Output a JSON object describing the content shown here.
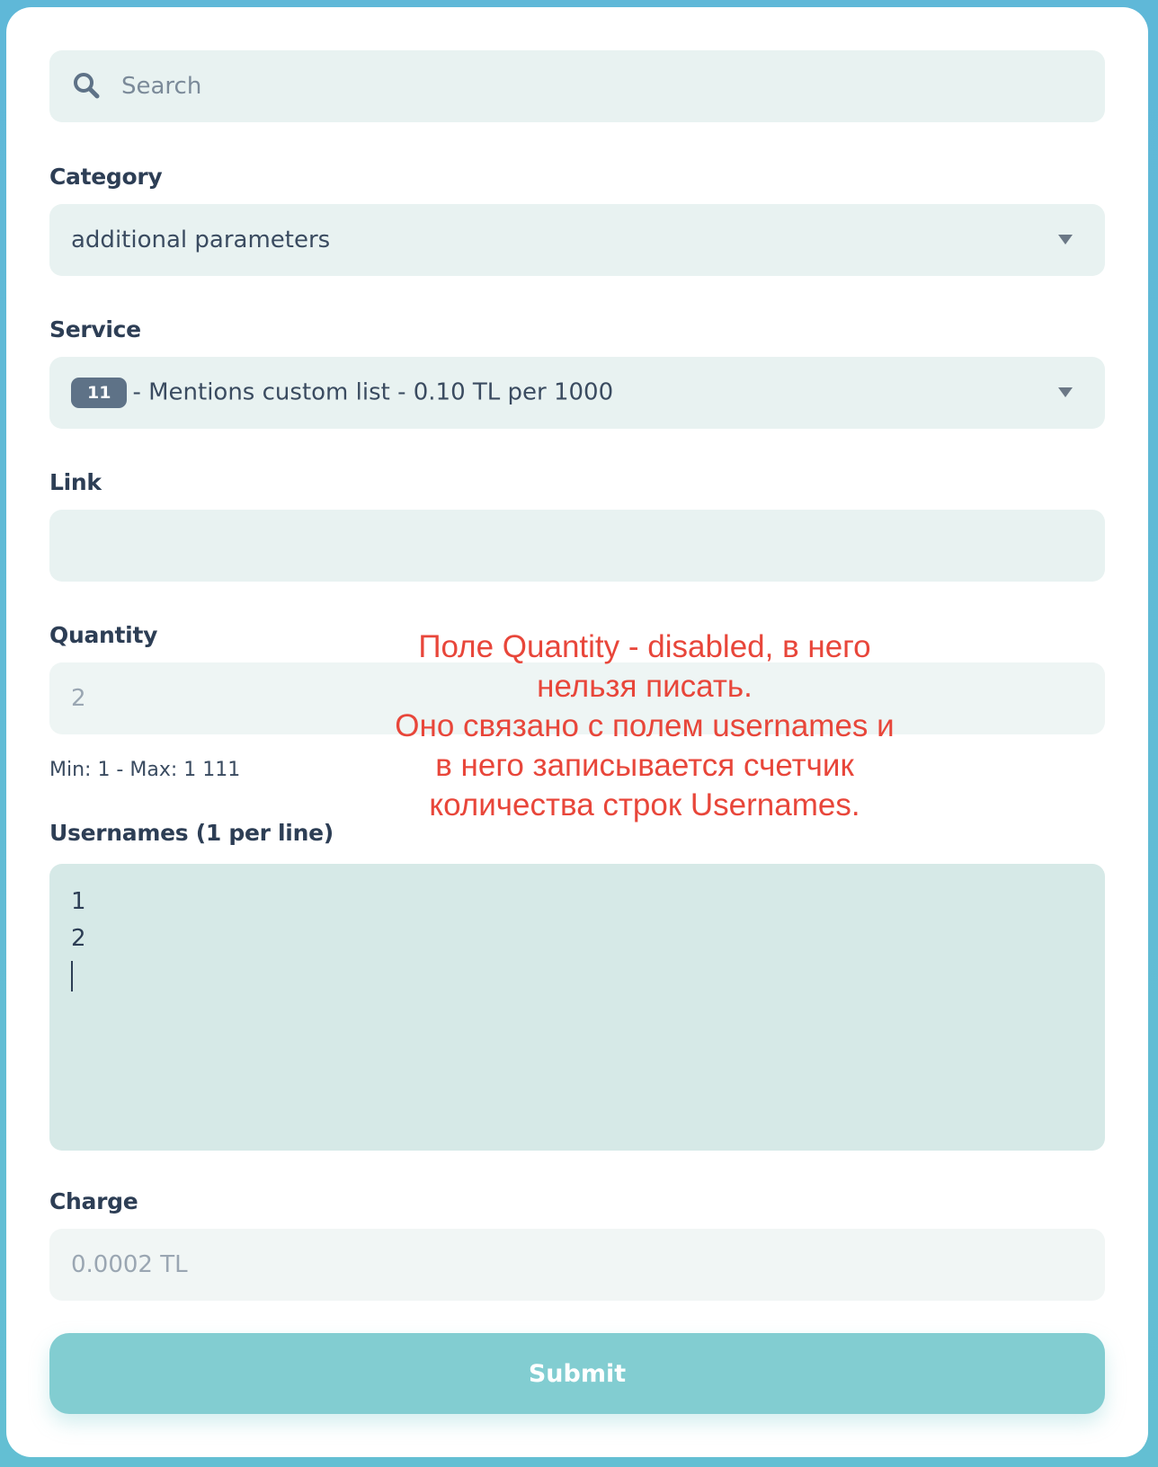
{
  "search": {
    "placeholder": "Search",
    "icon": "search-icon"
  },
  "category": {
    "label": "Category",
    "selected": "additional parameters"
  },
  "service": {
    "label": "Service",
    "badge": "11",
    "selected": "- Mentions custom list - 0.10 TL per 1000"
  },
  "link": {
    "label": "Link",
    "value": ""
  },
  "quantity": {
    "label": "Quantity",
    "value": "2",
    "hint": "Min: 1 - Max: 1 111"
  },
  "usernames": {
    "label": "Usernames (1 per line)",
    "lines": [
      "1",
      "2"
    ]
  },
  "charge": {
    "label": "Charge",
    "value": "0.0002 TL"
  },
  "submit": {
    "label": "Submit"
  },
  "annotation": {
    "lines": [
      "Поле Quantity - disabled, в него",
      "нельзя писать.",
      "Оно связано с полем usernames и",
      "в него записывается счетчик",
      "количества строк Usernames."
    ]
  },
  "colors": {
    "background": "#5fb8d8",
    "field": "#e8f2f1",
    "annotation": "#e8463a",
    "submit": "#82cdd1",
    "badge": "#5e7287"
  }
}
